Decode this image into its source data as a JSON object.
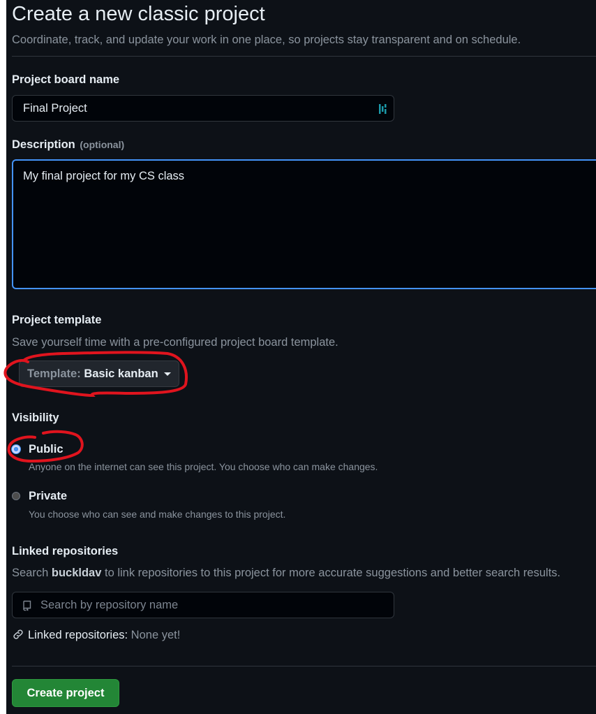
{
  "header": {
    "title": "Create a new classic project",
    "subtitle": "Coordinate, track, and update your work in one place, so projects stay transparent and on schedule."
  },
  "board_name": {
    "label": "Project board name",
    "value": "Final Project",
    "icon": "password-manager-icon"
  },
  "description": {
    "label": "Description",
    "optional": "(optional)",
    "value": "My final project for my CS class"
  },
  "template": {
    "label": "Project template",
    "hint": "Save yourself time with a pre-configured project board template.",
    "button_prefix": "Template:",
    "button_value": "Basic kanban",
    "annotation_color": "#e0141e"
  },
  "visibility": {
    "label": "Visibility",
    "selected": "Public",
    "options": [
      {
        "title": "Public",
        "description": "Anyone on the internet can see this project. You choose who can make changes."
      },
      {
        "title": "Private",
        "description": "You choose who can see and make changes to this project."
      }
    ]
  },
  "linked_repos": {
    "label": "Linked repositories",
    "hint_prefix": "Search",
    "owner": "buckldav",
    "hint_suffix": "to link repositories to this project for more accurate suggestions and better search results.",
    "search_placeholder": "Search by repository name",
    "status_label": "Linked repositories:",
    "status_value": "None yet!"
  },
  "actions": {
    "create_label": "Create project"
  },
  "colors": {
    "background": "#0d1117",
    "accent_blue": "#4493f8",
    "create_green": "#238636",
    "annotation_red": "#e0141e"
  }
}
